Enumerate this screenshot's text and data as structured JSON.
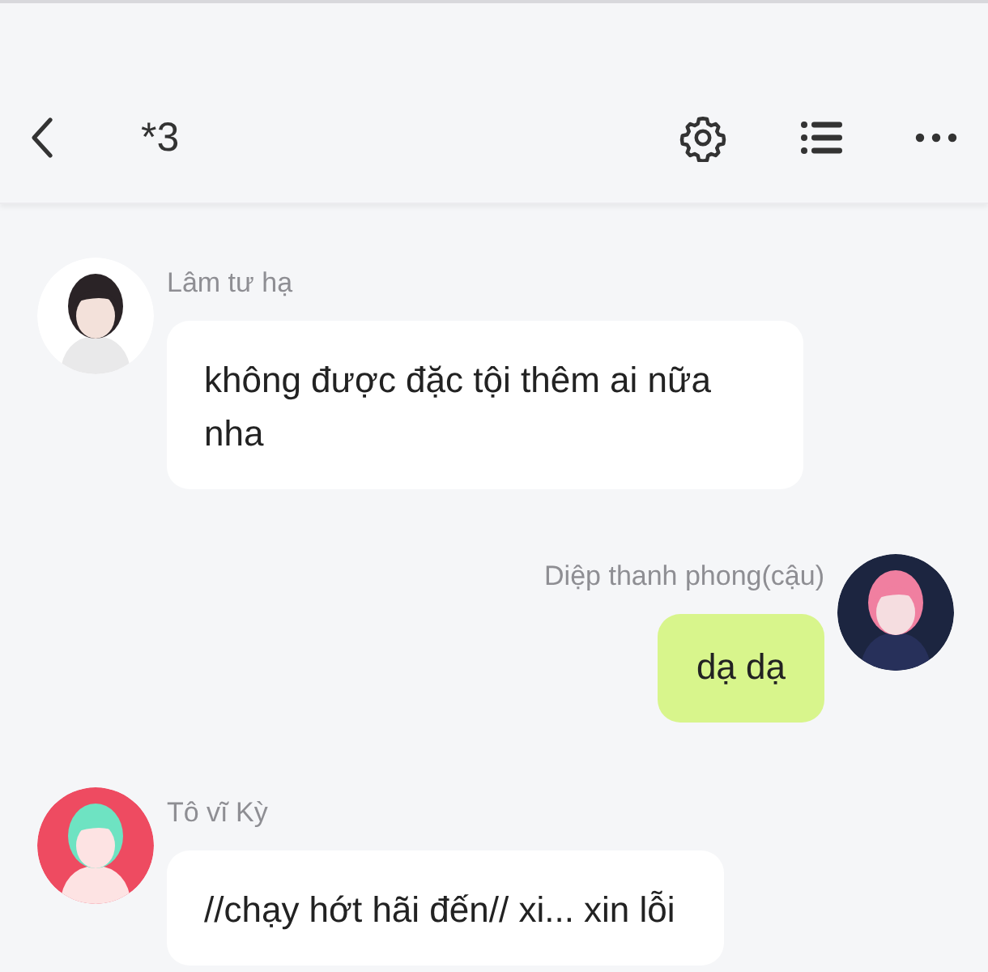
{
  "header": {
    "title": "*3"
  },
  "messages": [
    {
      "kind": "incoming",
      "sender": "Lâm tư hạ",
      "text": "không được đặc tội thêm ai nữa nha"
    },
    {
      "kind": "outgoing",
      "sender": "Diệp thanh phong(cậu)",
      "text": "dạ dạ"
    },
    {
      "kind": "incoming",
      "sender": "Tô vĩ Kỳ",
      "text": "//chạy hớt hãi đến// xi... xin lỗi"
    }
  ]
}
